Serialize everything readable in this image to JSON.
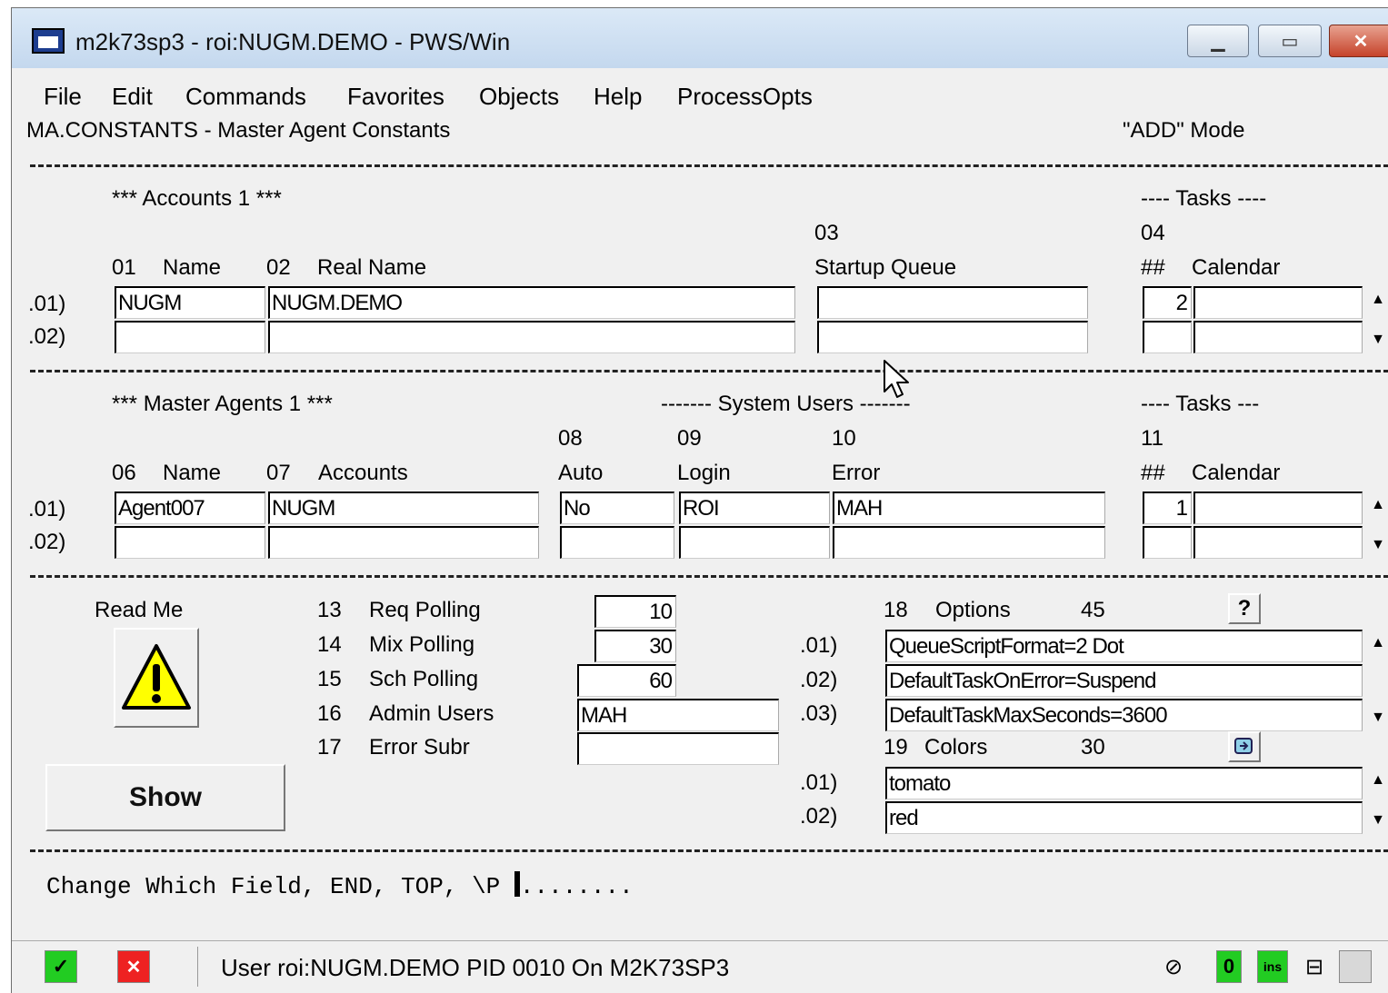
{
  "window": {
    "title": "m2k73sp3 - roi:NUGM.DEMO - PWS/Win",
    "minimize_glyph": "▁",
    "maximize_glyph": "▭",
    "close_glyph": "✕"
  },
  "menu": [
    "File",
    "Edit",
    "Commands",
    "Favorites",
    "Objects",
    "Help",
    "ProcessOpts"
  ],
  "screen": {
    "heading": "MA.CONSTANTS - Master Agent Constants",
    "mode": "\"ADD\" Mode"
  },
  "accounts": {
    "section_title": "*** Accounts  1 ***",
    "tasks_title": "---- Tasks ----",
    "col01_num": "01",
    "col01_label": "Name",
    "col02_num": "02",
    "col02_label": "Real Name",
    "col03_num": "03",
    "col03_label": "Startup Queue",
    "col04_num": "04",
    "col04_hash": "##",
    "col04_label": "Calendar",
    "row_labels": [
      ".01)",
      ".02)"
    ],
    "rows": [
      {
        "name": "NUGM",
        "real_name": "NUGM.DEMO",
        "startup_queue": "",
        "num": "2",
        "calendar": ""
      },
      {
        "name": "",
        "real_name": "",
        "startup_queue": "",
        "num": "",
        "calendar": ""
      }
    ]
  },
  "agents": {
    "section_title": "*** Master Agents  1 ***",
    "system_users_title": "------- System Users -------",
    "tasks_title": "---- Tasks ---",
    "col06_num": "06",
    "col06_label": "Name",
    "col07_num": "07",
    "col07_label": "Accounts",
    "col08_num": "08",
    "col08_label": "Auto",
    "col09_num": "09",
    "col09_label": "Login",
    "col10_num": "10",
    "col10_label": "Error",
    "col11_num": "11",
    "col11_hash": "##",
    "col11_label": "Calendar",
    "row_labels": [
      ".01)",
      ".02)"
    ],
    "rows": [
      {
        "name": "Agent007",
        "accounts": "NUGM",
        "auto": "No",
        "login": "ROI",
        "error": "MAH",
        "num": "1",
        "calendar": ""
      },
      {
        "name": "",
        "accounts": "",
        "auto": "",
        "login": "",
        "error": "",
        "num": "",
        "calendar": ""
      }
    ]
  },
  "settings": {
    "read_me_label": "Read Me",
    "show_button": "Show",
    "f13_num": "13",
    "f13_label": "Req Polling",
    "f13_value": "10",
    "f14_num": "14",
    "f14_label": "Mix Polling",
    "f14_value": "30",
    "f15_num": "15",
    "f15_label": "Sch Polling",
    "f15_value": "60",
    "f16_num": "16",
    "f16_label": "Admin Users",
    "f16_value": "MAH",
    "f17_num": "17",
    "f17_label": "Error Subr",
    "f17_value": ""
  },
  "options": {
    "num": "18",
    "label": "Options",
    "count": "45",
    "help_glyph": "?",
    "row_labels": [
      ".01)",
      ".02)",
      ".03)"
    ],
    "values": [
      "QueueScriptFormat=2 Dot",
      "DefaultTaskOnError=Suspend",
      "DefaultTaskMaxSeconds=3600"
    ]
  },
  "colors": {
    "num": "19",
    "label": "Colors",
    "count": "30",
    "row_labels": [
      ".01)",
      ".02)"
    ],
    "values": [
      "tomato",
      "red"
    ]
  },
  "prompt": {
    "text": "Change Which Field, END, TOP, \\P ",
    "dots": "........"
  },
  "statusbar": {
    "ok_glyph": "✓",
    "cancel_glyph": "✕",
    "user_text": "User roi:NUGM.DEMO PID 0010 On M2K73SP3",
    "num_indicator": "0",
    "ins_indicator": "ins"
  },
  "colors_ui": {
    "ok_green": "#22cc22",
    "cancel_red": "#ee2222",
    "warning_yellow": "#ffff00",
    "title_bar": "#c4d8ee"
  }
}
